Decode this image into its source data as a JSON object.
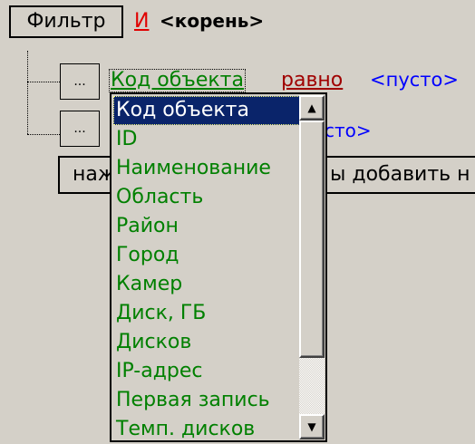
{
  "filter_button": "Фильтр",
  "logic_op": "И",
  "root_label": "<корень>",
  "rows": [
    {
      "ellipsis": "...",
      "field": "Код объекта",
      "operator": "равно",
      "value": "<пусто>"
    },
    {
      "ellipsis": "...",
      "value_fragment": "сто>"
    }
  ],
  "add_row": {
    "left": "наж",
    "right": "ы добавить н"
  },
  "dropdown": {
    "selected": "Код объекта",
    "items": [
      "Код объекта",
      "ID",
      "Наименование",
      "Область",
      "Район",
      "Город",
      "Камер",
      "Диск, ГБ",
      "Дисков",
      "IP-адрес",
      "Первая запись",
      "Темп. дисков"
    ]
  },
  "icons": {
    "scroll_up": "triangle-up",
    "scroll_down": "triangle-down"
  },
  "colors": {
    "field_green": "#008000",
    "operator_red": "#a00000",
    "value_blue": "#0000ff",
    "selection_bg": "#0a246a"
  }
}
